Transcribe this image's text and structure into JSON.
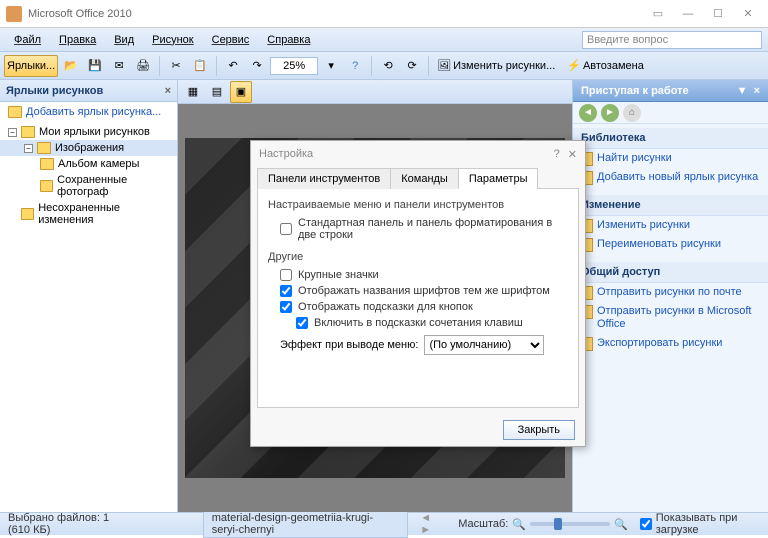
{
  "title": "Microsoft Office 2010",
  "menu": [
    "Файл",
    "Правка",
    "Вид",
    "Рисунок",
    "Сервис",
    "Справка"
  ],
  "questionPlaceholder": "Введите вопрос",
  "toolbar": {
    "tab": "Ярлыки...",
    "zoom": "25%",
    "btn_change": "Изменить рисунки...",
    "btn_auto": "Автозамена"
  },
  "leftPanel": {
    "header": "Ярлыки рисунков",
    "addLink": "Добавить ярлык рисунка...",
    "tree": {
      "root": "Мои ярлыки рисунков",
      "images": "Изображения",
      "camera": "Альбом камеры",
      "saved": "Сохраненные фотограф",
      "unsaved": "Несохраненные изменения"
    }
  },
  "rightPanel": {
    "header": "Приступая к работе",
    "sections": {
      "lib": "Библиотека",
      "libLinks": [
        "Найти рисунки",
        "Добавить новый ярлык рисунка"
      ],
      "edit": "Изменение",
      "editLinks": [
        "Изменить рисунки",
        "Переименовать рисунки"
      ],
      "share": "Общий доступ",
      "shareLinks": [
        "Отправить рисунки по почте",
        "Отправить рисунки в Microsoft Office",
        "Экспортировать рисунки"
      ]
    }
  },
  "dialog": {
    "title": "Настройка",
    "tabs": [
      "Панели инструментов",
      "Команды",
      "Параметры"
    ],
    "activeTab": 2,
    "group1": "Настраиваемые меню и панели инструментов",
    "opt1": "Стандартная панель и панель форматирования в две строки",
    "group2": "Другие",
    "opt2": "Крупные значки",
    "opt3": "Отображать названия шрифтов тем же шрифтом",
    "opt4": "Отображать подсказки для кнопок",
    "opt5": "Включить в подсказки сочетания клавиш",
    "effectLabel": "Эффект при выводе меню:",
    "effectValue": "(По умолчанию)",
    "closeBtn": "Закрыть"
  },
  "status": {
    "selected": "Выбрано файлов: 1 (610 КБ)",
    "filename": "material-design-geometriia-krugi-seryi-chernyi",
    "zoomLabel": "Масштаб:",
    "showOnLoad": "Показывать при загрузке"
  }
}
